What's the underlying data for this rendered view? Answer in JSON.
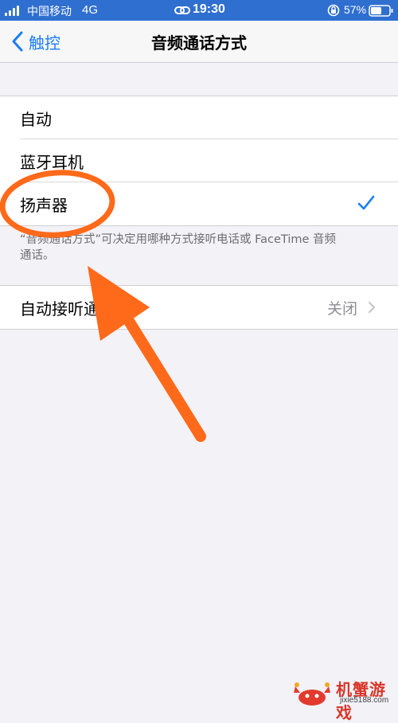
{
  "status_bar": {
    "carrier": "中国移动",
    "network": "4G",
    "time": "19:30",
    "battery": "57%"
  },
  "nav": {
    "back_label": "触控",
    "title": "音频通话方式"
  },
  "audio_routing": {
    "options": [
      {
        "label": "自动",
        "selected": false
      },
      {
        "label": "蓝牙耳机",
        "selected": false
      },
      {
        "label": "扬声器",
        "selected": true
      }
    ],
    "footer": "“音频通话方式”可决定用哪种方式接听电话或 FaceTime 音频通话。"
  },
  "auto_answer": {
    "label": "自动接听通",
    "value": "关闭"
  },
  "watermark": {
    "title": "机蟹游戏",
    "url": "jixie5188.com"
  },
  "colors": {
    "accent": "#1a7cf5",
    "annotation": "#ff6a1a",
    "status_bar": "#2f6fd0"
  },
  "icons": [
    "signal-icon",
    "link-icon",
    "rotation-lock-icon",
    "battery-icon",
    "chevron-left-icon",
    "checkmark-icon",
    "chevron-right-icon"
  ]
}
